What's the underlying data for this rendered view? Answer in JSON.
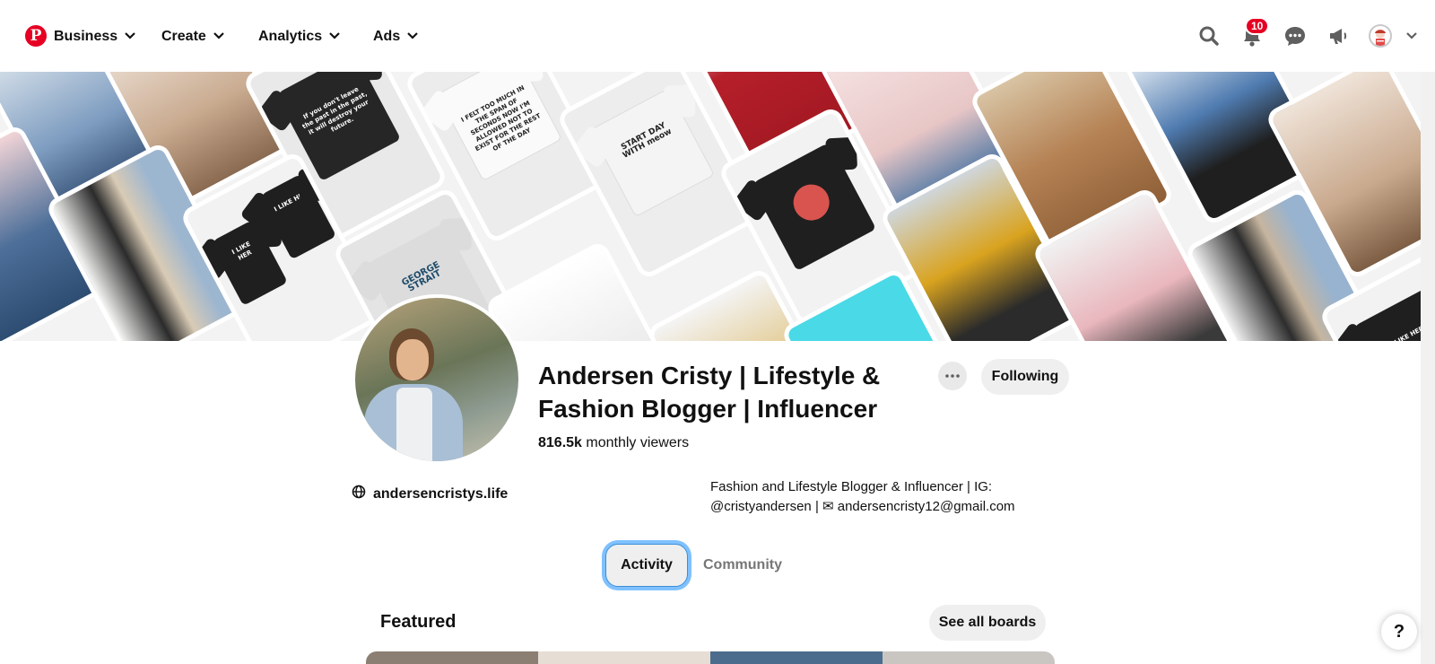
{
  "nav": {
    "business": "Business",
    "create": "Create",
    "analytics": "Analytics",
    "ads": "Ads",
    "notification_count": "10"
  },
  "cover": {
    "shirt_texts": [
      "If you don't leave the past in the past, it will destroy your future.",
      "I FELT TOO MUCH IN THE SPAN OF SECONDS NOW I'M ALLOWED NOT TO EXIST FOR THE REST OF THE DAY",
      "START DAY WITH meow",
      "I LIKE HER",
      "I LIKE HIS",
      "GEORGE STRAIT",
      "I LIKE HER"
    ]
  },
  "profile": {
    "name": "Andersen Cristy | Lifestyle & Fashion Blogger | Influencer",
    "viewers_count": "816.5k",
    "viewers_label": " monthly viewers",
    "following_label": "Following",
    "website": "andersencristys.life",
    "bio_line1": "Fashion and Lifestyle Blogger & Influencer | IG:",
    "bio_line2": "@cristyandersen | ✉ andersencristy12@gmail.com"
  },
  "tabs": {
    "activity": "Activity",
    "community": "Community"
  },
  "featured": {
    "title": "Featured",
    "see_all": "See all boards"
  },
  "help": "?",
  "colors": {
    "brand": "#e60023",
    "pill": "#efefef",
    "focus_ring": "#7fc1ff"
  }
}
